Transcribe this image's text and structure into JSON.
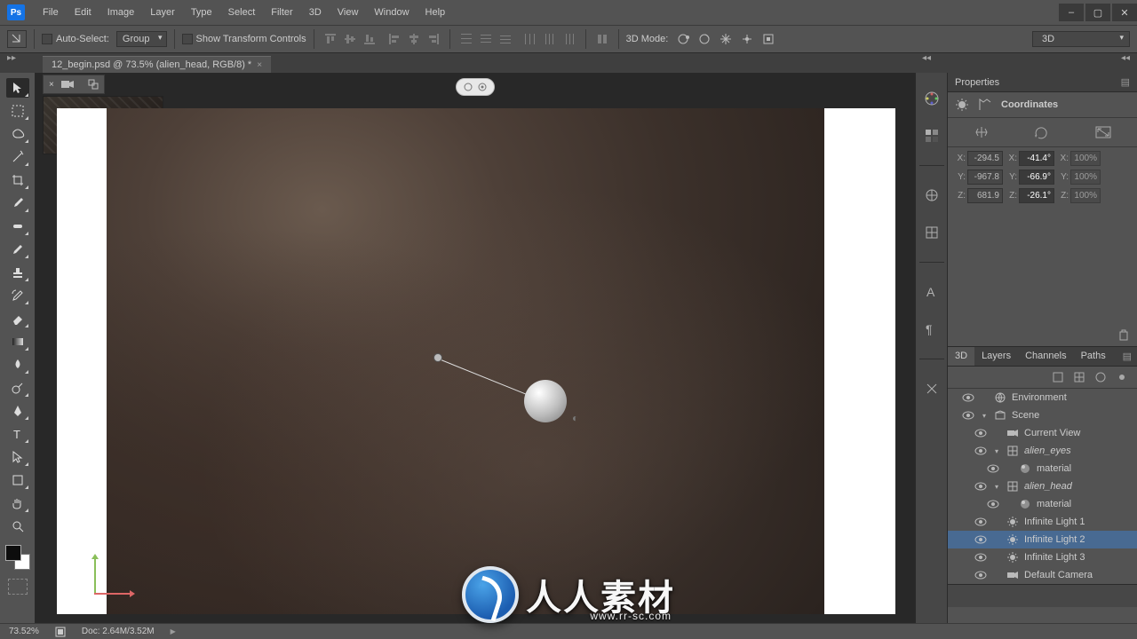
{
  "menubar": [
    "File",
    "Edit",
    "Image",
    "Layer",
    "Type",
    "Select",
    "Filter",
    "3D",
    "View",
    "Window",
    "Help"
  ],
  "options": {
    "auto_select": "Auto-Select:",
    "group": "Group",
    "show_transform": "Show Transform Controls",
    "mode3d_label": "3D Mode:"
  },
  "workspace": "3D",
  "doc_tab": "12_begin.psd @ 73.5% (alien_head, RGB/8) *",
  "status": {
    "zoom": "73.52%",
    "doc": "Doc: 2.64M/3.52M"
  },
  "properties": {
    "title": "Properties",
    "section": "Coordinates",
    "rows": {
      "x": {
        "pos": "-294.5",
        "rot": "-41.4°",
        "scale": "100%"
      },
      "y": {
        "pos": "-967.8",
        "rot": "-66.9°",
        "scale": "100%"
      },
      "z": {
        "pos": "681.9",
        "rot": "-26.1°",
        "scale": "100%"
      }
    }
  },
  "panel3d": {
    "tabs": [
      "3D",
      "Layers",
      "Channels",
      "Paths"
    ],
    "tree": [
      {
        "name": "Environment",
        "icon": "env",
        "indent": 1
      },
      {
        "name": "Scene",
        "icon": "scene",
        "indent": 1,
        "twisty": "▾"
      },
      {
        "name": "Current View",
        "icon": "camera",
        "indent": 2
      },
      {
        "name": "alien_eyes",
        "icon": "mesh",
        "indent": 2,
        "twisty": "▾",
        "italic": true
      },
      {
        "name": "material",
        "icon": "mat",
        "indent": 3
      },
      {
        "name": "alien_head",
        "icon": "mesh",
        "indent": 2,
        "twisty": "▾",
        "italic": true
      },
      {
        "name": "material",
        "icon": "mat",
        "indent": 3
      },
      {
        "name": "Infinite Light 1",
        "icon": "light",
        "indent": 2
      },
      {
        "name": "Infinite Light 2",
        "icon": "light",
        "indent": 2,
        "selected": true
      },
      {
        "name": "Infinite Light 3",
        "icon": "light",
        "indent": 2
      },
      {
        "name": "Default Camera",
        "icon": "camera",
        "indent": 2
      }
    ]
  },
  "watermark": {
    "text": "人人素材",
    "sub": "www.rr-sc.com"
  }
}
